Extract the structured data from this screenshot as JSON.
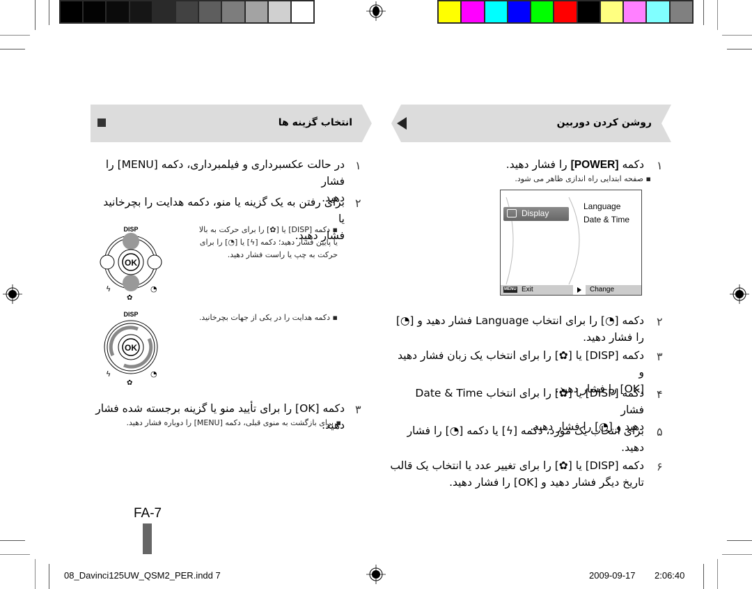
{
  "calibration": {
    "grayscale": [
      "#000000",
      "#030303",
      "#0b0b0b",
      "#161616",
      "#2a2a2a",
      "#424242",
      "#5e5e5e",
      "#7d7d7d",
      "#a3a3a3",
      "#d0d0d0",
      "#ffffff"
    ],
    "colors": [
      "#ffff00",
      "#ff00ff",
      "#00ffff",
      "#0000ff",
      "#00ff00",
      "#ff0000",
      "#000000",
      "#ffff80",
      "#ff80ff",
      "#80ffff",
      "#808080"
    ]
  },
  "right_section": {
    "title": "روشن کردن دوربین",
    "steps": [
      {
        "num": "۱",
        "text_before": "دکمه ",
        "key": "[POWER]",
        "text_after": " را فشار دهید.",
        "bullet": "صفحه ابتدایی راه اندازی ظاهر می شود."
      },
      {
        "num": "۲",
        "line1": "دکمه [◔] را برای انتخاب Language فشار دهید و [◔]",
        "line2": "را فشار دهید."
      },
      {
        "num": "۳",
        "line1": "دکمه [DISP] یا [✿] را برای انتخاب یک زبان فشار دهید و",
        "line2": "[OK] را فشار دهید."
      },
      {
        "num": "۴",
        "line1": "دکمه [DISP] یا [✿] را برای انتخاب Date & Time فشار",
        "line2": "دهید و [◔] را فشار دهید."
      },
      {
        "num": "۵",
        "line1": "برای انتخاب یک مورد، دکمه [ϟ] یا دکمه [◔] را فشار",
        "line2": "دهید."
      },
      {
        "num": "۶",
        "line1": "دکمه [DISP] یا [✿] را برای تغییر عدد یا انتخاب یک قالب",
        "line2": "تاریخ دیگر فشار دهید و [OK] را فشار دهید."
      }
    ],
    "lcd": {
      "menu_tab": "Display",
      "items": [
        "Language",
        "Date & Time"
      ],
      "exit_key": "MENU",
      "exit_label": "Exit",
      "change_label": "Change"
    }
  },
  "left_section": {
    "title": "انتخاب گزینه ها",
    "steps": [
      {
        "num": "۱",
        "line1": "در حالت عکسبرداری و فیلمبرداری، دکمه [MENU] را فشار",
        "line2": "دهید."
      },
      {
        "num": "۲",
        "line1": "برای رفتن به یک گزینه یا منو، دکمه هدایت را بچرخانید یا",
        "line2": "فشار دهید.",
        "bullet1": [
          "دکمه [DISP] یا [✿] را برای حرکت به بالا",
          "یا پایین فشار دهید؛ دکمه [ϟ] یا [◔] را برای",
          "حرکت به چپ یا راست فشار دهید."
        ],
        "bullet2": "دکمه هدایت را در یکی از جهات بچرخانید."
      },
      {
        "num": "۳",
        "line1": "دکمه [OK] را برای تأیید منو یا گزینه برجسته شده فشار دهید.",
        "bullet": "برای بازگشت به منوی قبلی، دکمه [MENU] را دوباره فشار دهید."
      }
    ],
    "dial": {
      "top_label": "DISP",
      "center_label": "OK"
    }
  },
  "page_number": "FA-7",
  "footer": {
    "file": "08_Davinci125UW_QSM2_PER.indd   7",
    "date": "2009-09-17",
    "time": "2:06:40"
  }
}
